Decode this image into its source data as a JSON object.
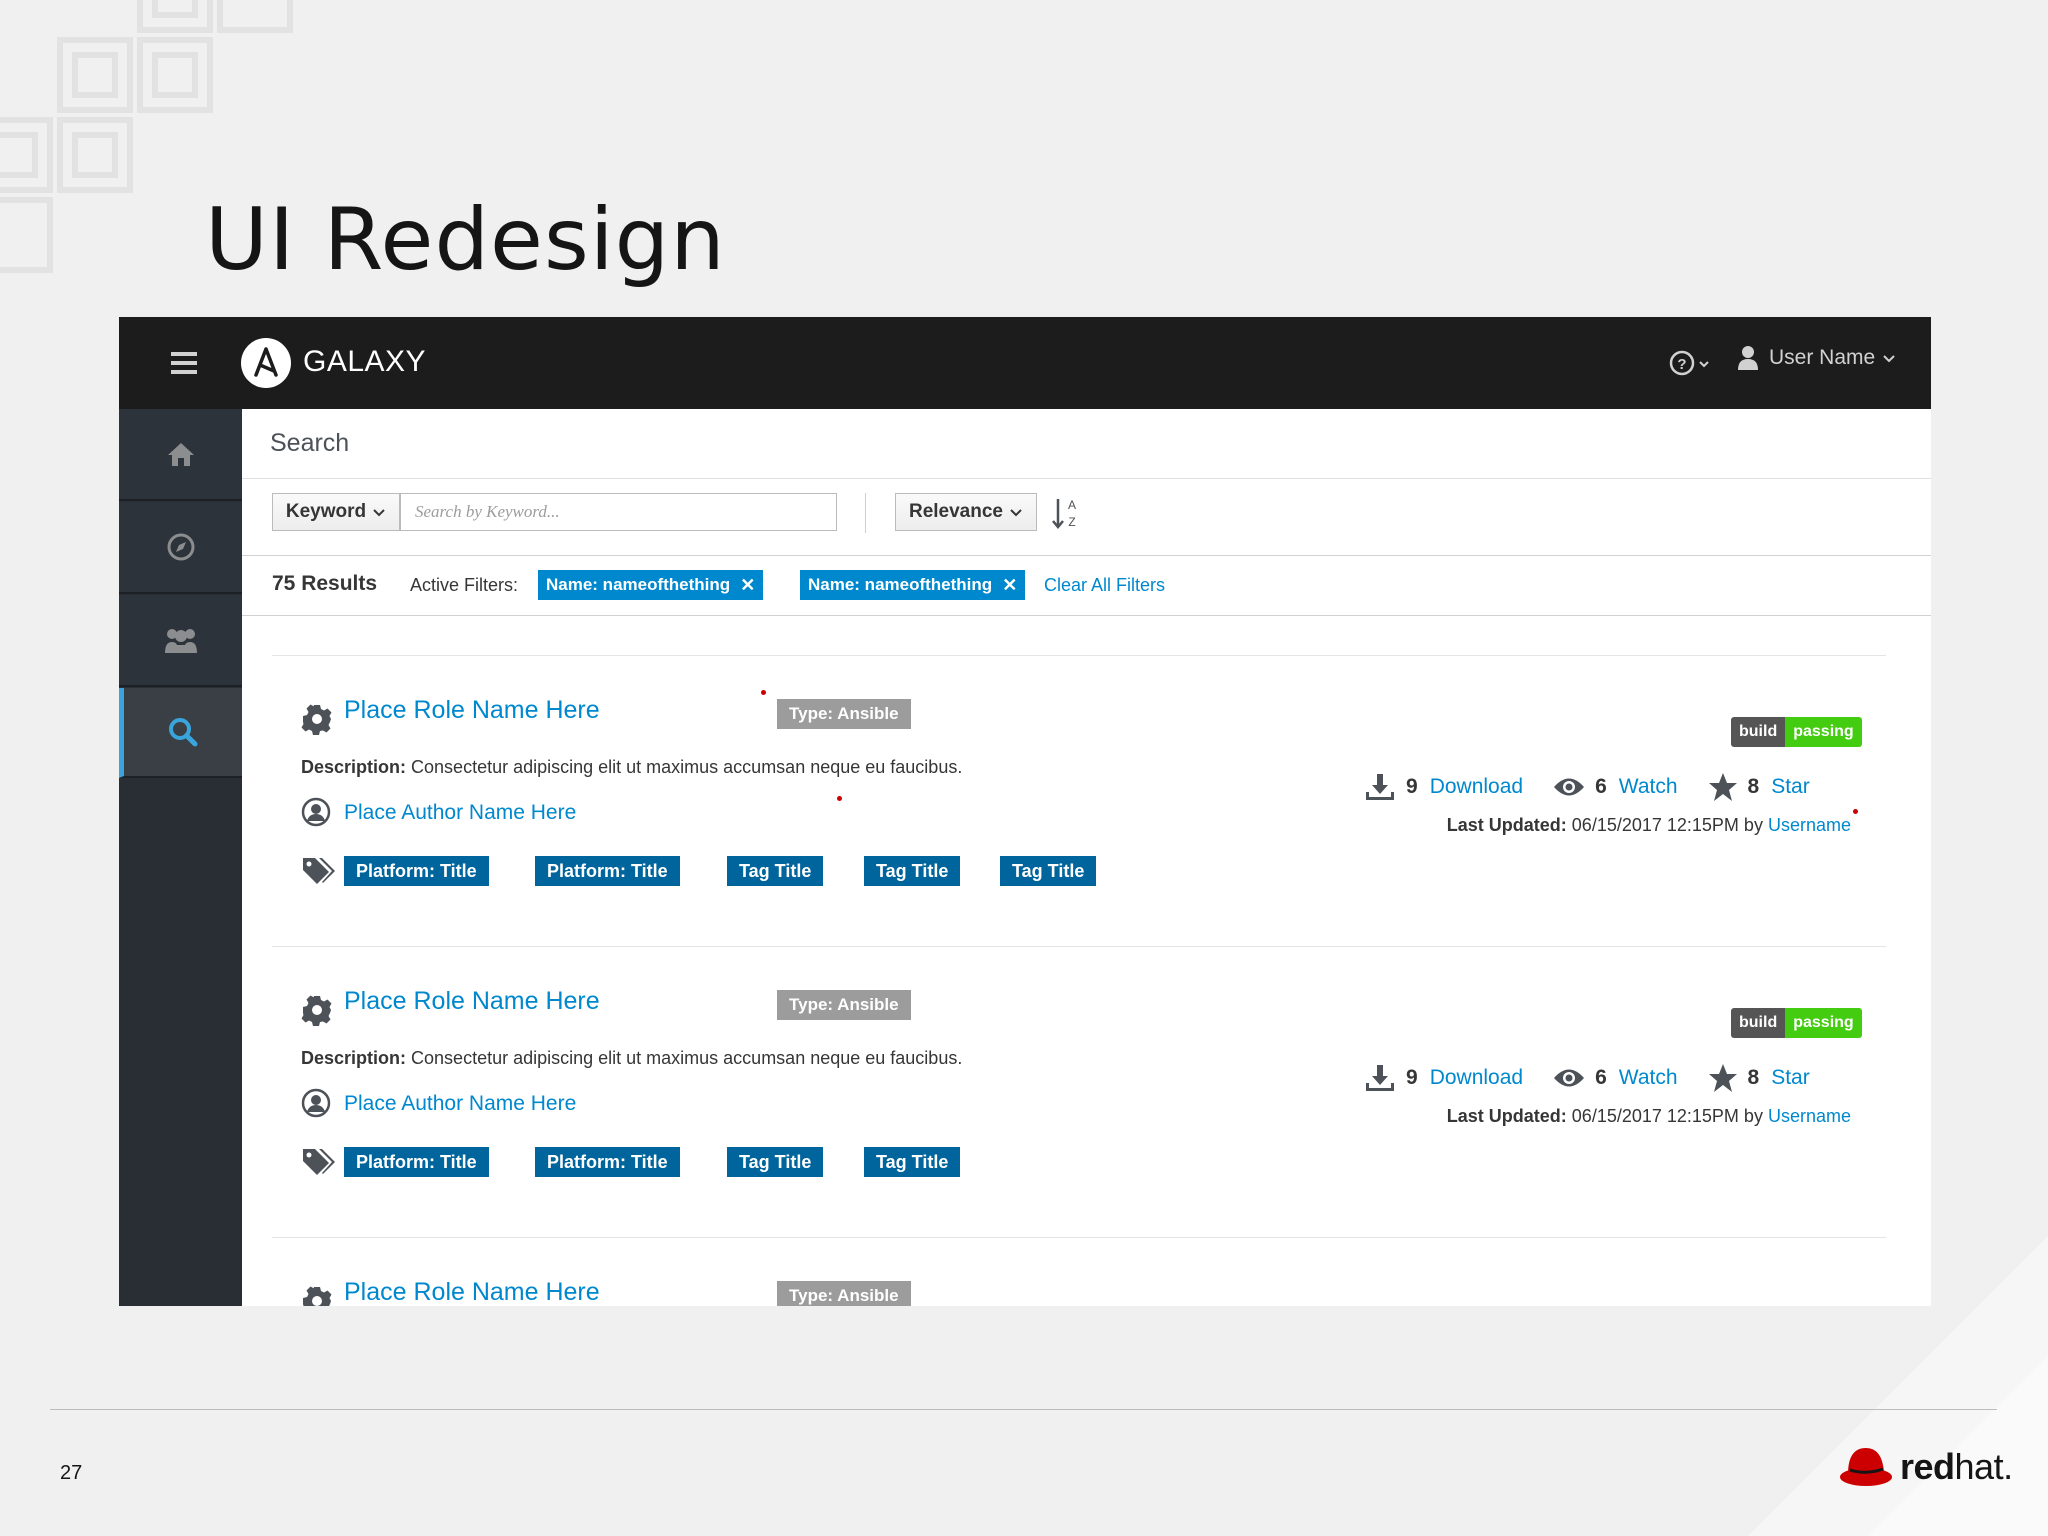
{
  "slide": {
    "title": "UI Redesign",
    "page_number": "27"
  },
  "brand": {
    "logo_red": "redhat",
    "logo_red_bold": "red",
    "logo_red_rest": "hat."
  },
  "app": {
    "name": "GALAXY",
    "user_name": "User Name",
    "nav": [
      {
        "name": "home",
        "icon": "home-icon"
      },
      {
        "name": "explore",
        "icon": "compass-icon"
      },
      {
        "name": "community",
        "icon": "users-icon"
      },
      {
        "name": "search",
        "icon": "search-icon",
        "active": true
      }
    ],
    "page_title": "Search",
    "toolbar": {
      "filter_field": "Keyword",
      "search_placeholder": "Search by Keyword...",
      "sort_field": "Relevance"
    },
    "filters": {
      "results": "75 Results",
      "active_label": "Active Filters:",
      "chips": [
        "Name: nameofthething",
        "Name: nameofthething"
      ],
      "clear_label": "Clear All Filters"
    },
    "results": [
      {
        "role_name": "Place Role Name Here",
        "type": "Type: Ansible",
        "desc_label": "Description:",
        "description": "Consectetur adipiscing elit ut maximus accumsan neque eu faucibus.",
        "author": "Place Author Name Here",
        "tags": [
          "Platform: Title",
          "Platform: Title",
          "Tag Title",
          "Tag Title",
          "Tag Title"
        ],
        "build_left": "build",
        "build_right": "passing",
        "downloads": "9",
        "download_label": "Download",
        "watches": "6",
        "watch_label": "Watch",
        "stars": "8",
        "star_label": "Star",
        "updated_label": "Last Updated:",
        "updated_text": "06/15/2017 12:15PM by",
        "updated_user": "Username"
      },
      {
        "role_name": "Place Role Name Here",
        "type": "Type: Ansible",
        "desc_label": "Description:",
        "description": "Consectetur adipiscing elit ut maximus accumsan neque eu faucibus.",
        "author": "Place Author Name Here",
        "tags": [
          "Platform: Title",
          "Platform: Title",
          "Tag Title",
          "Tag Title"
        ],
        "build_left": "build",
        "build_right": "passing",
        "downloads": "9",
        "download_label": "Download",
        "watches": "6",
        "watch_label": "Watch",
        "stars": "8",
        "star_label": "Star",
        "updated_label": "Last Updated:",
        "updated_text": "06/15/2017 12:15PM by",
        "updated_user": "Username"
      },
      {
        "role_name": "Place Role Name Here",
        "type": "Type: Ansible"
      }
    ]
  },
  "colors": {
    "link": "#0088ce",
    "masthead": "#1c1c1c",
    "sidebar": "#292e34",
    "tag": "#00659c",
    "passing": "#44cc11",
    "redhat": "#cc0000"
  }
}
